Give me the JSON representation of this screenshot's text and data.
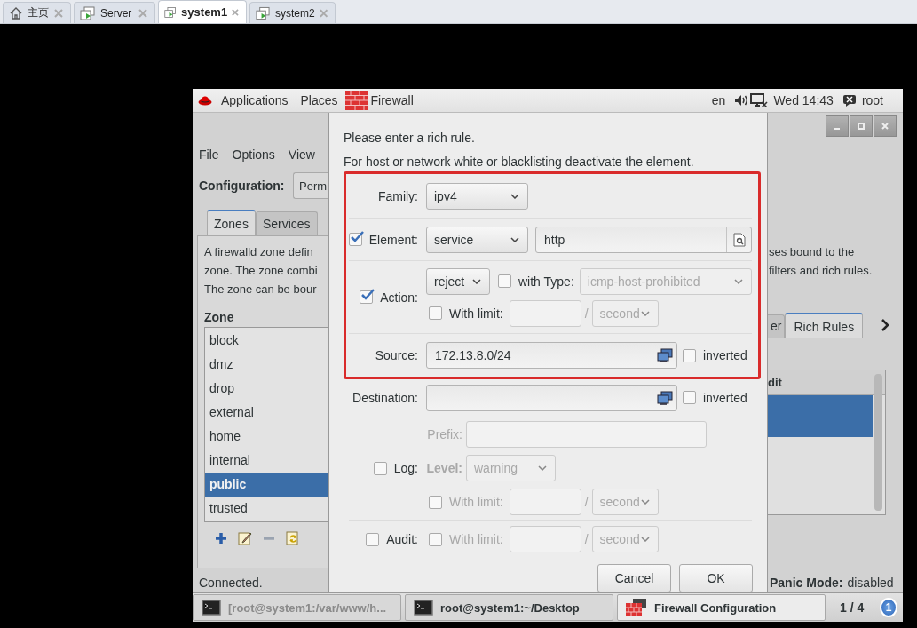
{
  "viewer_tabs": [
    {
      "label": "主页",
      "kind": "home",
      "selected": false
    },
    {
      "label": "Server",
      "kind": "vm",
      "selected": false
    },
    {
      "label": "system1",
      "kind": "vm",
      "selected": true
    },
    {
      "label": "system2",
      "kind": "vm",
      "selected": false
    }
  ],
  "panel": {
    "menus": [
      "Applications",
      "Places"
    ],
    "app": "Firewall",
    "keyboard": "en",
    "clock": "Wed 14:43",
    "user": "root"
  },
  "main_window": {
    "menus": [
      "File",
      "Options",
      "View"
    ],
    "config_label": "Configuration:",
    "config_value": "Perm",
    "tabs": [
      {
        "label": "Zones",
        "selected": true
      },
      {
        "label": "Services",
        "selected": false
      }
    ],
    "description_left": [
      "A firewalld zone defin",
      "zone. The zone combi",
      "The zone can be bour"
    ],
    "description_right": [
      "ses bound to the",
      "filters and rich rules."
    ],
    "zone_heading": "Zone",
    "zones": [
      {
        "name": "block",
        "selected": false
      },
      {
        "name": "dmz",
        "selected": false
      },
      {
        "name": "drop",
        "selected": false
      },
      {
        "name": "external",
        "selected": false
      },
      {
        "name": "home",
        "selected": false
      },
      {
        "name": "internal",
        "selected": false
      },
      {
        "name": "public",
        "selected": true
      },
      {
        "name": "trusted",
        "selected": false
      }
    ],
    "detail_tabs": [
      {
        "label": "er",
        "selected": false
      },
      {
        "label": "Rich Rules",
        "selected": true
      }
    ],
    "rules_table": {
      "column_header": "dit",
      "rows": [
        {
          "selected": true
        }
      ]
    },
    "status": "Connected.",
    "panic_label": "Panic Mode:",
    "panic_value": "disabled"
  },
  "dialog": {
    "intro": "Please enter a rich rule.",
    "hint": "For host or network white or blacklisting deactivate the element.",
    "family": {
      "label": "Family:",
      "value": "ipv4"
    },
    "element": {
      "checked": true,
      "label": "Element:",
      "type": "service",
      "value": "http"
    },
    "action": {
      "checked": true,
      "label": "Action:",
      "value": "reject",
      "with_type": {
        "checked": false,
        "label": "with Type:",
        "value": "icmp-host-prohibited"
      },
      "limit": {
        "checked": false,
        "disabled": false,
        "label": "With limit:",
        "separator": "/",
        "unit": "second"
      }
    },
    "source": {
      "label": "Source:",
      "value": "172.13.8.0/24",
      "inverted": {
        "checked": false,
        "label": "inverted"
      }
    },
    "destination": {
      "label": "Destination:",
      "inverted": {
        "checked": false,
        "label": "inverted"
      }
    },
    "log": {
      "checked": false,
      "label": "Log:",
      "prefix_label": "Prefix:",
      "level_label": "Level:",
      "level_value": "warning",
      "limit": {
        "checked": false,
        "disabled": true,
        "label": "With limit:",
        "separator": "/",
        "unit": "second"
      }
    },
    "audit": {
      "checked": false,
      "label": "Audit:",
      "limit": {
        "checked": false,
        "disabled": true,
        "label": "With limit:",
        "separator": "/",
        "unit": "second"
      }
    },
    "buttons": [
      "Cancel",
      "OK"
    ]
  },
  "taskbar": {
    "items": [
      {
        "label": "[root@system1:/var/www/h...",
        "kind": "terminal",
        "minimized": true,
        "selected": false
      },
      {
        "label": "root@system1:~/Desktop",
        "kind": "terminal",
        "minimized": false,
        "selected": false
      },
      {
        "label": "Firewall Configuration",
        "kind": "firewall",
        "minimized": false,
        "selected": true
      }
    ],
    "workspace": "1 / 4",
    "notifications": "1"
  }
}
